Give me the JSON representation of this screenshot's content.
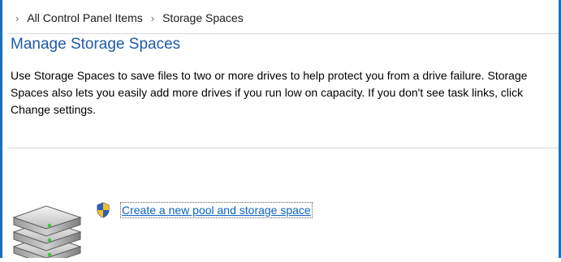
{
  "breadcrumb": {
    "items": [
      "All Control Panel Items",
      "Storage Spaces"
    ]
  },
  "main": {
    "title": "Manage Storage Spaces",
    "description": "Use Storage Spaces to save files to two or more drives to help protect you from a drive failure. Storage Spaces also lets you easily add more drives if you run low on capacity. If you don't see task links, click Change settings.",
    "task_link": "Create a new pool and storage space"
  },
  "icons": {
    "breadcrumb_separator": "chevron-right-icon",
    "drives": "storage-drives-icon",
    "uac": "uac-shield-icon"
  },
  "colors": {
    "window_border": "#1c6fbd",
    "title": "#1e5aa8",
    "link": "#0b62c1"
  }
}
